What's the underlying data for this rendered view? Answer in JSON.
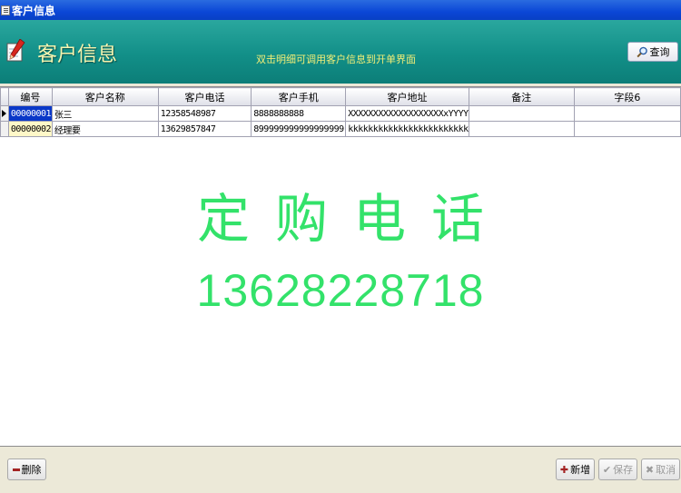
{
  "window": {
    "title": "客户信息"
  },
  "banner": {
    "title": "客户信息",
    "hint": "双击明细可调用客户信息到开单界面",
    "query_label": "查询"
  },
  "grid": {
    "columns": [
      "编号",
      "客户名称",
      "客户电话",
      "客户手机",
      "客户地址",
      "备注",
      "字段6"
    ],
    "rows": [
      [
        "00000001",
        "张三",
        "12358548987",
        "8888888888",
        "XXXXXXXXXXXXXXXXXXXxYYYY",
        "",
        ""
      ],
      [
        "00000002",
        "经理要",
        "13629857847",
        "899999999999999999",
        "kkkkkkkkkkkkkkkkkkkkkkkk",
        "",
        ""
      ]
    ]
  },
  "promo": {
    "line1": "定购电话",
    "line2": "13628228718"
  },
  "footer": {
    "delete_label": "删除",
    "add_label": "新增",
    "save_label": "保存",
    "cancel_label": "取消"
  },
  "colors": {
    "banner": "#128f88",
    "promo_text": "#33e26a",
    "selection": "#0a38c8",
    "title_bar": "#0a46d6"
  },
  "icons": {
    "title": "window-icon",
    "banner": "pencil-notepad-icon",
    "query": "magnifier-icon",
    "delete": "minus-icon",
    "add": "plus-icon",
    "save": "check-icon",
    "cancel": "x-icon"
  }
}
